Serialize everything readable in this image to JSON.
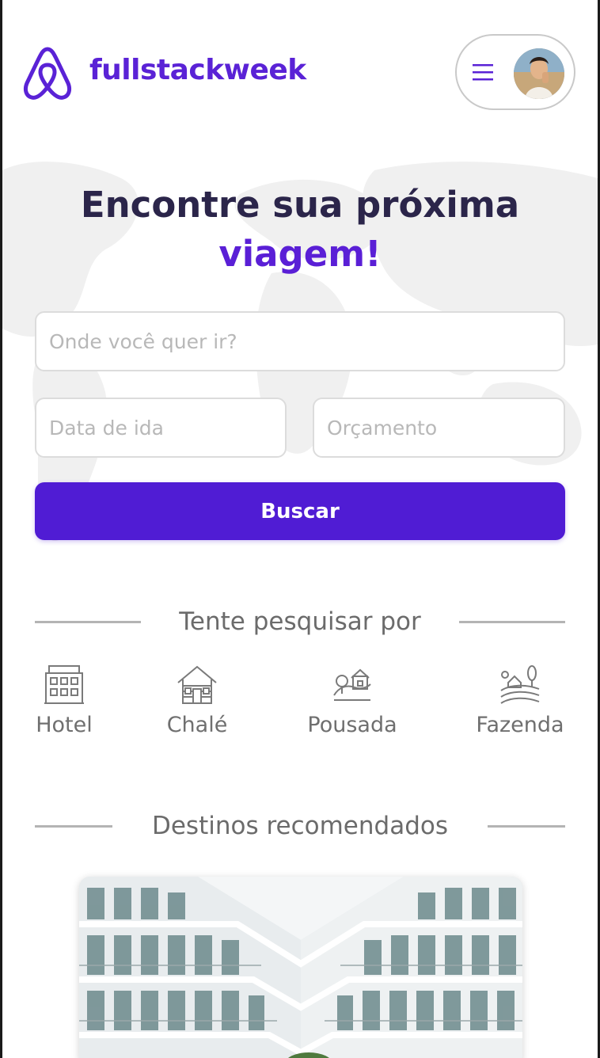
{
  "header": {
    "brand": "fullstackweek",
    "logo_icon": "airbnb-logo-icon",
    "menu_icon": "hamburger-menu-icon",
    "avatar": "user-avatar",
    "accent_color": "#5a22d6"
  },
  "hero": {
    "title_line1": "Encontre sua próxima",
    "title_line2": "viagem!",
    "destination_placeholder": "Onde você quer ir?",
    "date_placeholder": "Data de ida",
    "budget_placeholder": "Orçamento",
    "search_button": "Buscar",
    "button_color": "#501cd4"
  },
  "quick_search": {
    "heading": "Tente pesquisar por",
    "categories": [
      {
        "label": "Hotel",
        "icon": "hotel-icon"
      },
      {
        "label": "Chalé",
        "icon": "chalet-icon"
      },
      {
        "label": "Pousada",
        "icon": "inn-icon"
      },
      {
        "label": "Fazenda",
        "icon": "farm-icon"
      }
    ]
  },
  "recommended": {
    "heading": "Destinos recomendados",
    "cards": [
      {
        "image": "hotel-building-photo"
      }
    ]
  }
}
